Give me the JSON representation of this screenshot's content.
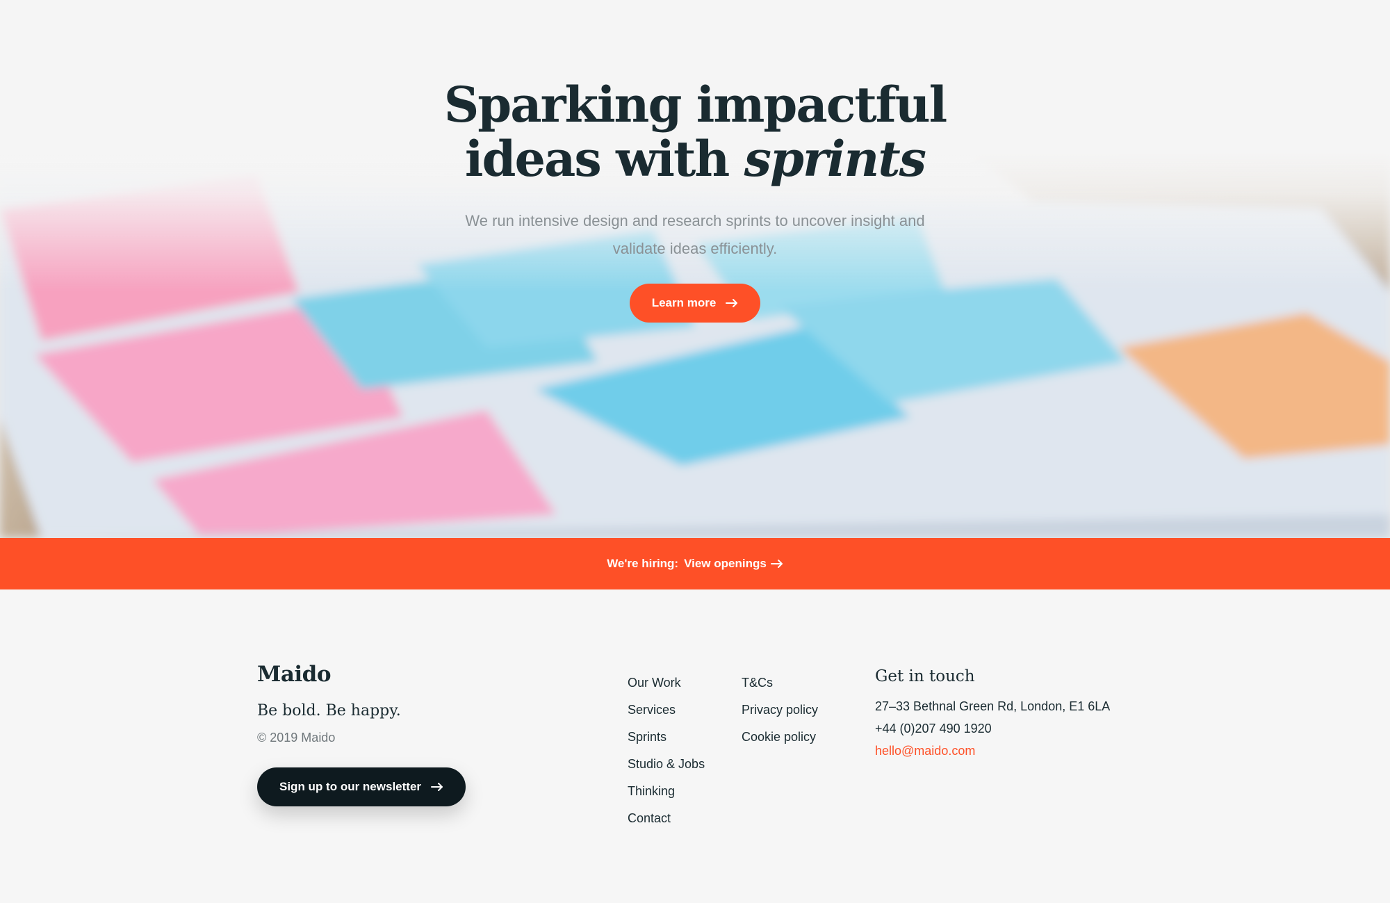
{
  "hero": {
    "title_line1": "Sparking impactful",
    "title_line2_plain": "ideas with ",
    "title_line2_emphasis": "sprints",
    "subtitle": "We run intensive design and research sprints to uncover insight and validate ideas efficiently.",
    "cta_label": "Learn more"
  },
  "hiring": {
    "label": "We're hiring:",
    "link_label": "View openings"
  },
  "footer": {
    "brand": "Maido",
    "tagline": "Be bold. Be happy.",
    "copyright": "© 2019 Maido",
    "newsletter_label": "Sign up to our newsletter",
    "nav_primary": [
      "Our Work",
      "Services",
      "Sprints",
      "Studio & Jobs",
      "Thinking",
      "Contact"
    ],
    "nav_legal": [
      "T&Cs",
      "Privacy policy",
      "Cookie policy"
    ],
    "contact": {
      "title": "Get in touch",
      "address": "27–33 Bethnal Green Rd, London, E1 6LA",
      "phone": "+44 (0)207 490 1920",
      "email": "hello@maido.com"
    }
  },
  "colors": {
    "accent": "#fe5027",
    "dark": "#0e1a1f",
    "text": "#1a2b31",
    "muted": "#8a9195"
  }
}
